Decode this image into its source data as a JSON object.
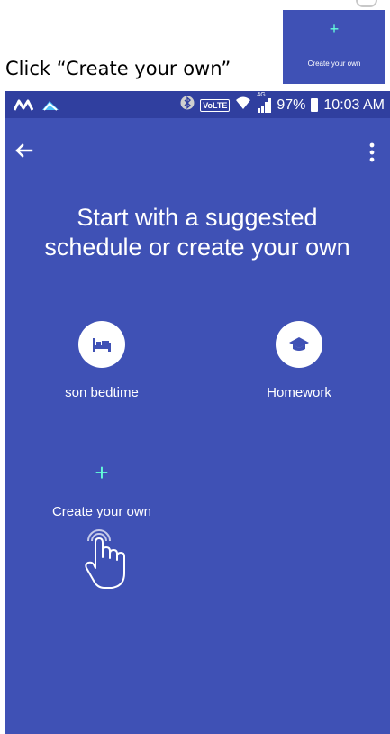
{
  "instruction": {
    "text": "Click “Create your own”",
    "thumbnail": {
      "plus": "+",
      "label": "Create your own"
    }
  },
  "status_bar": {
    "left_icons": [
      "m-logo-icon",
      "cloud-app-icon"
    ],
    "right_icons": [
      "bluetooth-icon",
      "volte-badge",
      "wifi-icon",
      "signal-icon",
      "battery-icon"
    ],
    "volte": "VoLTE",
    "network": "4G",
    "battery": "97%",
    "time": "10:03 AM"
  },
  "toolbar": {
    "back_icon": "arrow-left-icon",
    "menu_icon": "more-vert-icon"
  },
  "headline": "Start with a suggested\nschedule or create your own",
  "options": [
    {
      "label": "son bedtime",
      "icon": "bed-icon"
    },
    {
      "label": "Homework",
      "icon": "graduation-cap-icon"
    }
  ],
  "create_own": {
    "plus": "+",
    "label": "Create your own"
  },
  "cursor": "tap-hand-icon",
  "colors": {
    "primary": "#3f51b5",
    "primary_dark": "#303f9f",
    "accent": "#64ffda",
    "icon": "#3f51b5",
    "text": "#ffffff"
  }
}
